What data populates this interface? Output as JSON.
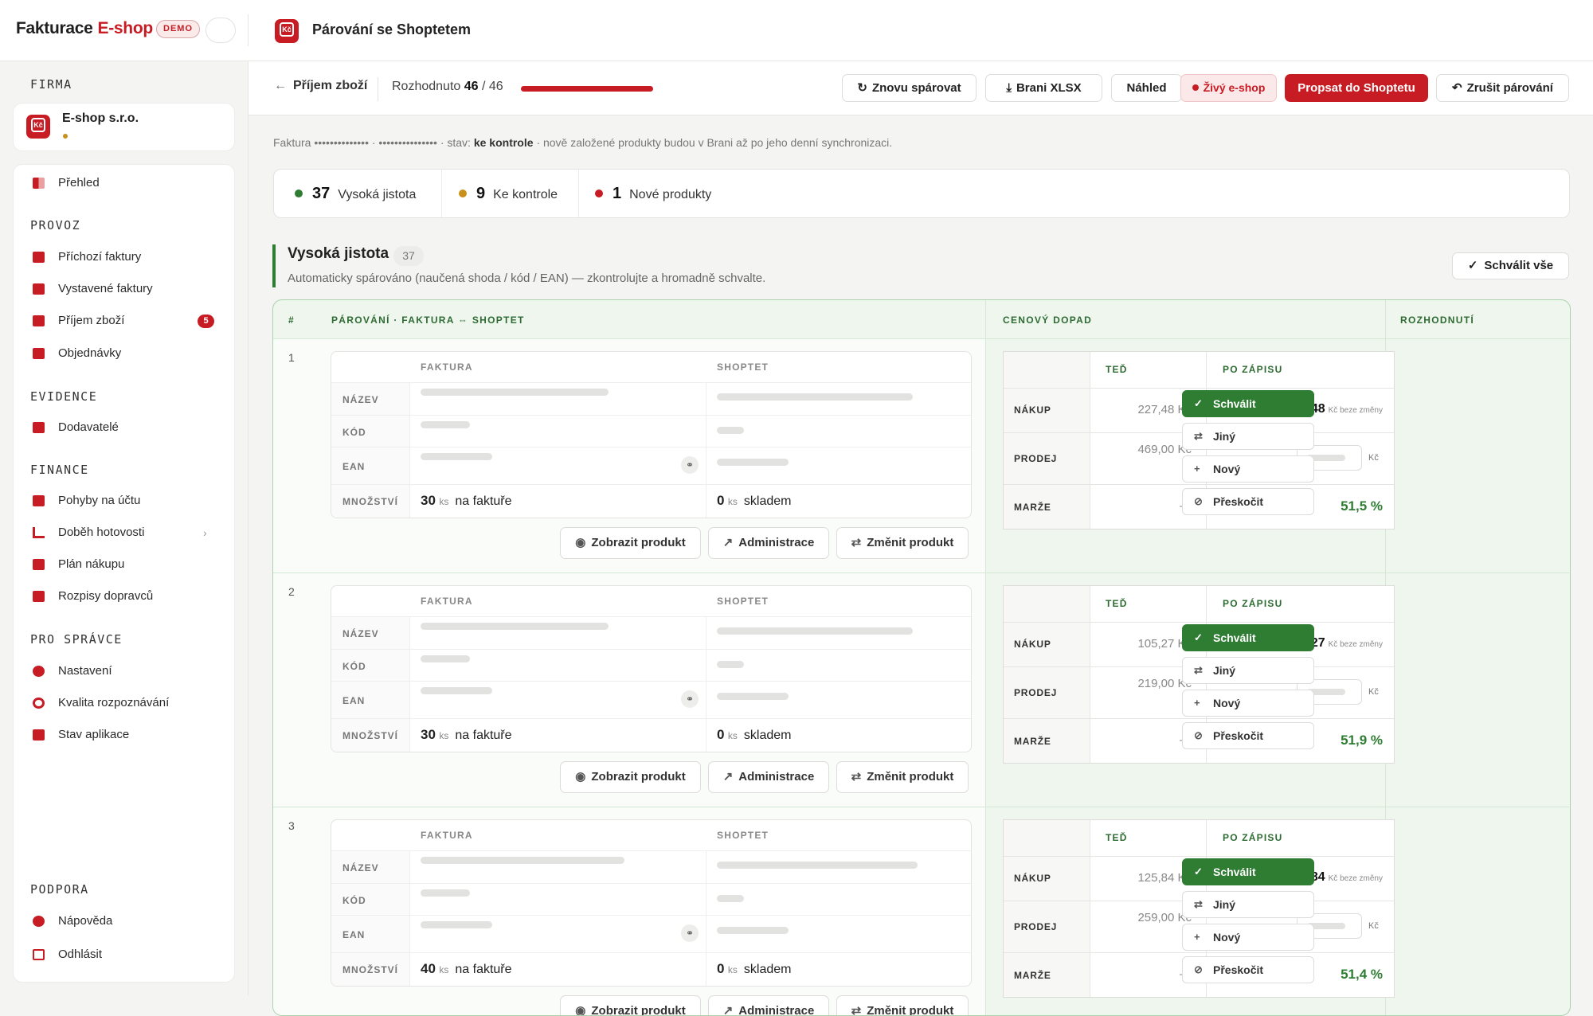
{
  "app": {
    "brand": "Fakturace",
    "brand_accent": "E-shop",
    "demo_badge": "DEMO",
    "page_title": "Párování se Shoptetem",
    "logo_glyph": "Kč"
  },
  "sidebar": {
    "firma_label": "FIRMA",
    "company_name": "E-shop s.r.o.",
    "overview": "Přehled",
    "sections": [
      {
        "title": "PROVOZ",
        "items": [
          "Příchozí faktury",
          "Vystavené faktury",
          "Příjem zboží",
          "Objednávky"
        ]
      },
      {
        "title": "EVIDENCE",
        "items": [
          "Dodavatelé"
        ]
      },
      {
        "title": "FINANCE",
        "items": [
          "Pohyby na účtu",
          "Doběh hotovosti",
          "Plán nákupu",
          "Rozpisy dopravců"
        ]
      },
      {
        "title": "PRO SPRÁVCE",
        "items": [
          "Nastavení",
          "Kvalita rozpoznávání",
          "Stav aplikace"
        ]
      },
      {
        "title": "PODPORA",
        "items": [
          "Nápověda",
          "Odhlásit"
        ]
      }
    ],
    "receipt_badge": "5"
  },
  "toolbar": {
    "back": "Příjem zboží",
    "decided_label": "Rozhodnuto",
    "decided_done": "46",
    "decided_total": "/ 46",
    "progress_fraction": 1.0,
    "rematch": "Znovu spárovat",
    "xlsx": "Brani XLSX",
    "preview": "Náhled",
    "live": "Živý e-shop",
    "write": "Propsat do Shoptetu",
    "cancel": "Zrušit párování"
  },
  "info": {
    "prefix": "Faktura •••••••••••••• · ••••••••••••••• · stav:",
    "status": "ke kontrole",
    "suffix": "· nově založené produkty budou v Brani až po jeho denní synchronizaci."
  },
  "stats": [
    {
      "count": "37",
      "label": "Vysoká jistota",
      "color": "#2e7d32"
    },
    {
      "count": "9",
      "label": "Ke kontrole",
      "color": "#c9901c"
    },
    {
      "count": "1",
      "label": "Nové produkty",
      "color": "#c81c24"
    }
  ],
  "group": {
    "title": "Vysoká jistota",
    "count": "37",
    "subtitle": "Automaticky spárováno (naučená shoda / kód / EAN) — zkontrolujte a hromadně schvalte.",
    "approve_all": "Schválit vše"
  },
  "table": {
    "headers": {
      "num": "#",
      "pairing": "PÁROVÁNÍ · FAKTURA ⇔ SHOPTET",
      "price": "CENOVÝ DOPAD",
      "decision": "ROZHODNUTÍ"
    },
    "card_headers": {
      "invoice": "FAKTURA",
      "shop": "SHOPTET"
    },
    "row_labels": {
      "name": "NÁZEV",
      "code": "KÓD",
      "ean": "EAN",
      "qty": "MNOŽSTVÍ"
    },
    "qty_unit": "ks",
    "on_invoice": "na faktuře",
    "in_stock": "skladem",
    "actions": {
      "show": "Zobrazit produkt",
      "admin": "Administrace",
      "change": "Změnit produkt"
    },
    "price_headers": {
      "now": "TEĎ",
      "after": "PO ZÁPISU"
    },
    "price_labels": {
      "buy": "NÁKUP",
      "sell": "PRODEJ",
      "margin": "MARŽE"
    },
    "no_change": "Kč beze změny",
    "currency": "Kč",
    "decisions": {
      "approve": "Schválit",
      "other": "Jiný",
      "new": "Nový",
      "skip": "Přeskočit"
    },
    "rows": [
      {
        "num": "1",
        "invoice_qty": "30",
        "stock_qty": "0",
        "buy_now": "227,48 Kč",
        "buy_after": "227,48",
        "sell_now": "469,00 Kč",
        "margin_now": "—",
        "margin_after": "51,5 %"
      },
      {
        "num": "2",
        "invoice_qty": "30",
        "stock_qty": "0",
        "buy_now": "105,27 Kč",
        "buy_after": "105,27",
        "sell_now": "219,00 Kč",
        "margin_now": "—",
        "margin_after": "51,9 %"
      },
      {
        "num": "3",
        "invoice_qty": "40",
        "stock_qty": "0",
        "buy_now": "125,84 Kč",
        "buy_after": "125,84",
        "sell_now": "259,00 Kč",
        "margin_now": "—",
        "margin_after": "51,4 %"
      }
    ]
  }
}
